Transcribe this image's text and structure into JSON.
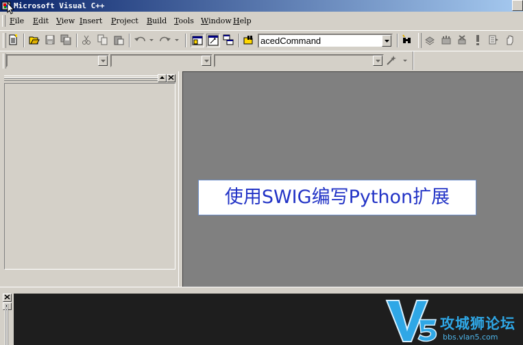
{
  "window": {
    "title": "Microsoft Visual C++"
  },
  "menu": [
    {
      "acc": "F",
      "rest": "ile"
    },
    {
      "acc": "E",
      "rest": "dit"
    },
    {
      "acc": "V",
      "rest": "iew"
    },
    {
      "acc": "I",
      "rest": "nsert"
    },
    {
      "acc": "P",
      "rest": "roject"
    },
    {
      "acc": "B",
      "rest": "uild"
    },
    {
      "acc": "T",
      "rest": "ools"
    },
    {
      "acc": "W",
      "rest": "indow"
    },
    {
      "acc": "H",
      "rest": "elp"
    }
  ],
  "toolbar": {
    "find_combo_value": "acedCommand",
    "icons": [
      "new-text-file-icon",
      "open-icon",
      "save-icon",
      "save-all-icon",
      "cut-icon",
      "copy-icon",
      "paste-icon",
      "undo-icon",
      "redo-icon",
      "workspace-icon",
      "output-window-icon",
      "window-list-icon",
      "find-in-files-icon",
      "find-icon",
      "compile-icon",
      "build-icon",
      "stop-build-icon",
      "execute-icon",
      "go-icon",
      "breakpoint-icon"
    ]
  },
  "wizardbar": {
    "class_combo": "",
    "filter_combo": "",
    "members_combo": ""
  },
  "banner": {
    "text": "使用SWIG编写Python扩展"
  },
  "watermark": {
    "brand": "攻城狮论坛",
    "url": "bbs.vlan5.com",
    "logo_letters": "V5"
  },
  "colors": {
    "titlebar_start": "#0a246a",
    "titlebar_end": "#a6caf0",
    "banner_text": "#2233c6",
    "watermark": "#2fa7e6"
  }
}
